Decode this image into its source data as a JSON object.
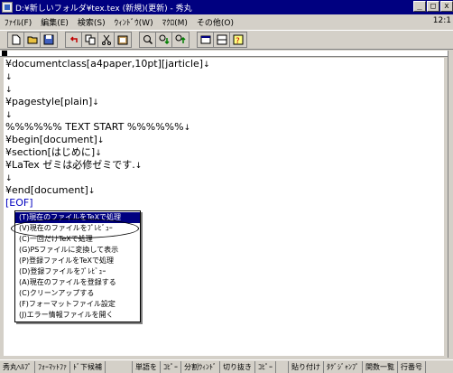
{
  "window": {
    "title": "D:¥新しいフォルダ¥tex.tex (新規)(更新) - 秀丸",
    "minimize": "_",
    "restore": "□",
    "close": "x"
  },
  "menubar": {
    "items": [
      "ﾌｧｲﾙ(F)",
      "編集(E)",
      "検索(S)",
      "ｳｨﾝﾄﾞｳ(W)",
      "ﾏｸﾛ(M)",
      "その他(O)"
    ],
    "position": "12:1"
  },
  "toolbar": {
    "icons": [
      "new-file-icon",
      "open-folder-icon",
      "save-icon",
      "undo-icon",
      "copy-icon",
      "cut-icon",
      "paste-icon",
      "search-icon",
      "search-next-icon",
      "search-prev-icon",
      "window-icon",
      "split-icon",
      "help-icon"
    ]
  },
  "editor": {
    "lines": [
      {
        "text": "¥documentclass[a4paper,10pt][jarticle]",
        "eol": "↓"
      },
      {
        "text": "",
        "eol": "↓"
      },
      {
        "text": "",
        "eol": "↓"
      },
      {
        "text": "¥pagestyle[plain]",
        "eol": "↓"
      },
      {
        "text": "",
        "eol": "↓"
      },
      {
        "text": "%%%%%%    TEXT START    %%%%%%",
        "eol": "↓"
      },
      {
        "text": "¥begin[document]",
        "eol": "↓"
      },
      {
        "text": "¥section[はじめに]",
        "eol": "↓"
      },
      {
        "text": "¥LaTex ゼミは必修ゼミです.",
        "eol": "↓"
      },
      {
        "text": "",
        "eol": "↓"
      },
      {
        "text": "¥end[document]",
        "eol": "↓"
      },
      {
        "text": "[EOF]",
        "eol": ""
      }
    ]
  },
  "context_menu": {
    "items": [
      {
        "label": "(T)現在のファイルをTeXで処理",
        "selected": true
      },
      {
        "label": "(V)現在のファイルをﾌﾟﾚﾋﾞｭｰ",
        "selected": false
      },
      {
        "label": "(C)一回だけTeXで処理",
        "selected": false
      },
      {
        "label": "(G)PSファイルに変換して表示",
        "selected": false
      },
      {
        "label": "(P)登録ファイルをTeXで処理",
        "selected": false
      },
      {
        "label": "(D)登録ファイルをﾌﾟﾚﾋﾞｭｰ",
        "selected": false
      },
      {
        "label": "(A)現在のファイルを登録する",
        "selected": false
      },
      {
        "label": "(C)クリーンアップする",
        "selected": false
      },
      {
        "label": "(F)フォーマットファイル設定",
        "selected": false
      },
      {
        "label": "(J)エラー情報ファイルを開く",
        "selected": false
      }
    ]
  },
  "statusbar": {
    "items": [
      "秀丸ﾍﾙﾌﾟ",
      "ﾌｫｰﾏｯﾄﾌｧ",
      "ﾄﾞ下候補",
      "",
      "単語を",
      "ｺﾋﾟｰ",
      "分割ｳｨﾝﾄﾞ",
      "切り抜き",
      "ｺﾋﾟｰ",
      "",
      "貼り付け",
      "ﾀｸﾞｼﾞｬﾝﾌﾟ",
      "関数一覧",
      "行番号"
    ]
  }
}
